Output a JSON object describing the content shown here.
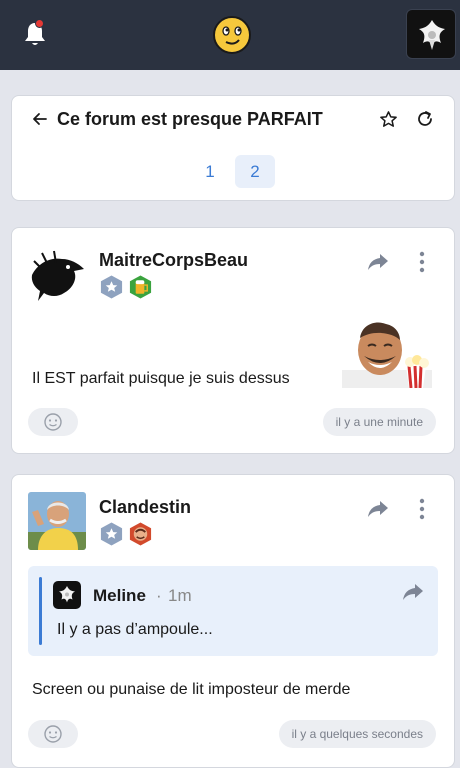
{
  "topic": {
    "title": "Ce forum est presque PARFAIT",
    "pages": [
      "1",
      "2"
    ],
    "current_page": "2"
  },
  "posts": [
    {
      "author": "MaitreCorpsBeau",
      "text": "Il EST parfait puisque je suis dessus",
      "time": "il y a une minute"
    },
    {
      "author": "Clandestin",
      "quote": {
        "author": "Meline",
        "separator": "·",
        "time": "1m",
        "text": "Il y a pas d’ampoule..."
      },
      "text": "Screen ou punaise de lit imposteur de merde",
      "time": "il y a quelques secondes"
    }
  ],
  "colors": {
    "topbar": "#2b3240",
    "accent": "#3b7bd4",
    "notification_dot": "#e53935"
  }
}
